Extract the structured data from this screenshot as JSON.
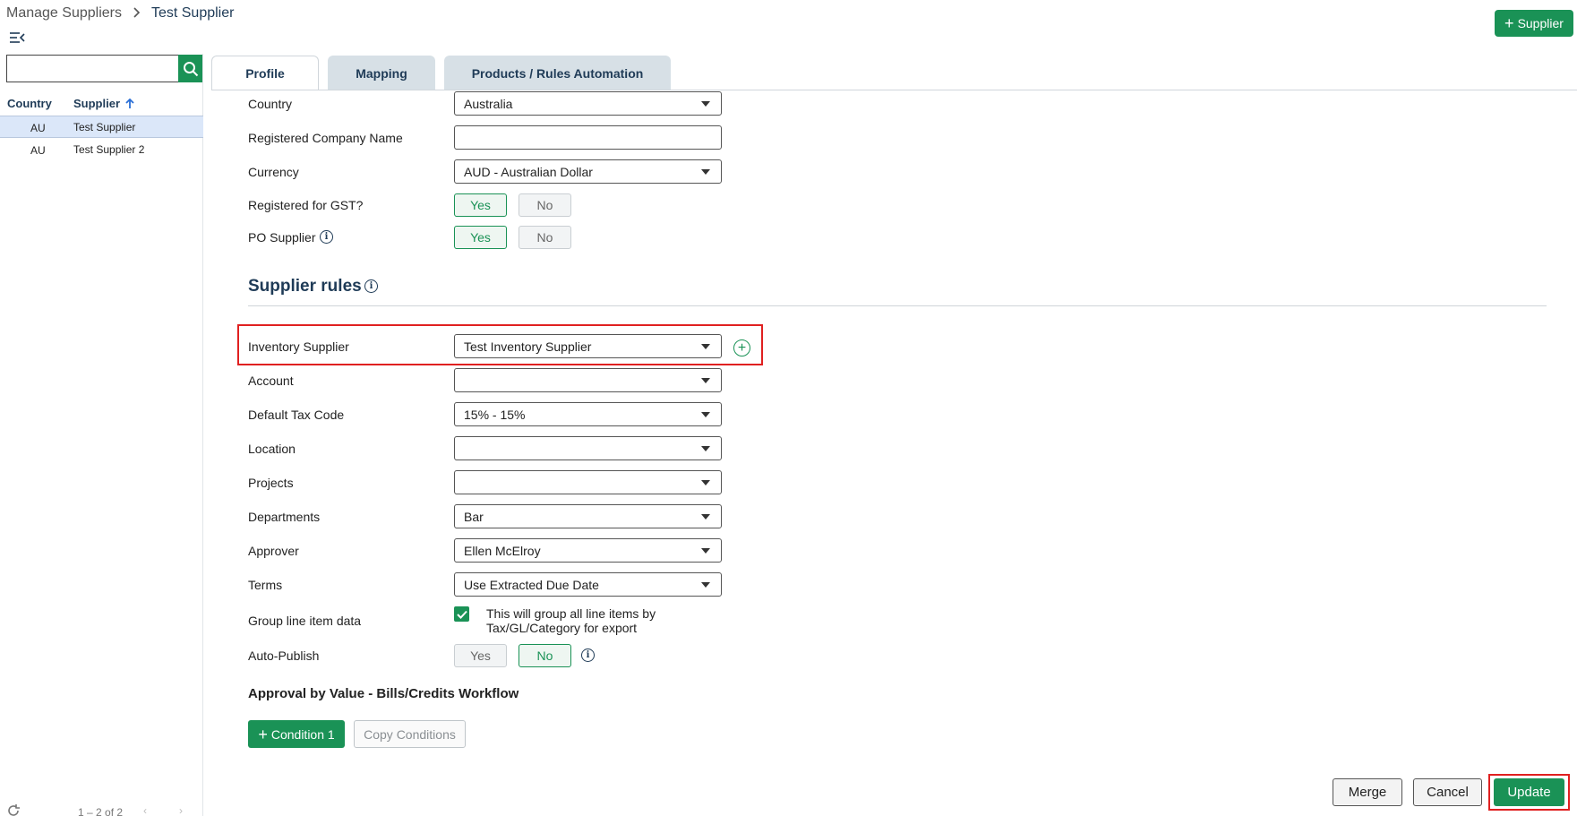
{
  "breadcrumb": {
    "parent": "Manage Suppliers",
    "separator": ">",
    "current": "Test Supplier"
  },
  "header": {
    "add_supplier_label": "Supplier"
  },
  "sidebar": {
    "search_placeholder": "",
    "columns": {
      "country": "Country",
      "supplier": "Supplier"
    },
    "rows": [
      {
        "country": "AU",
        "name": "Test Supplier",
        "selected": true
      },
      {
        "country": "AU",
        "name": "Test Supplier 2",
        "selected": false
      }
    ],
    "pagination": "1 – 2 of 2"
  },
  "tabs": [
    "Profile",
    "Mapping",
    "Products / Rules Automation"
  ],
  "profile": {
    "country_label": "Country",
    "country_value": "Australia",
    "registered_company_label": "Registered Company Name",
    "registered_company_value": "",
    "currency_label": "Currency",
    "currency_value": "AUD - Australian Dollar",
    "gst_label": "Registered for GST?",
    "po_supplier_label": "PO Supplier",
    "yes": "Yes",
    "no": "No"
  },
  "supplier_rules": {
    "title": "Supplier rules",
    "inventory_supplier_label": "Inventory Supplier",
    "inventory_supplier_value": "Test Inventory Supplier",
    "account_label": "Account",
    "account_value": "",
    "tax_code_label": "Default Tax Code",
    "tax_code_value": "15% - 15%",
    "location_label": "Location",
    "location_value": "",
    "projects_label": "Projects",
    "projects_value": "",
    "departments_label": "Departments",
    "departments_value": "Bar",
    "approver_label": "Approver",
    "approver_value": "Ellen McElroy",
    "terms_label": "Terms",
    "terms_value": "Use Extracted Due Date",
    "group_line_label": "Group line item data",
    "group_line_desc": "This will group all line items by Tax/GL/Category for export",
    "auto_publish_label": "Auto-Publish"
  },
  "approval": {
    "title": "Approval by Value - Bills/Credits Workflow",
    "condition_label": "Condition 1",
    "copy_label": "Copy Conditions"
  },
  "footer": {
    "merge": "Merge",
    "cancel": "Cancel",
    "update": "Update"
  },
  "colors": {
    "brand_green": "#1a9256",
    "navy": "#1f3b57",
    "highlight_red": "#e02020",
    "selected_row": "#dbe7f9"
  }
}
